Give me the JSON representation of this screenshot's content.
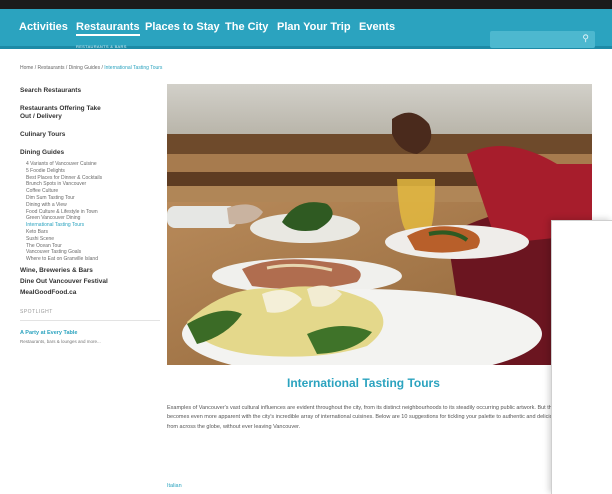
{
  "nav": {
    "items": [
      "Activities",
      "Restaurants",
      "Places to Stay",
      "The City",
      "Plan Your Trip",
      "Events"
    ],
    "active_sub": "RESTAURANTS & BARS"
  },
  "breadcrumb": {
    "home": "Home",
    "restaurants": "Restaurants",
    "guides": "Dining Guides",
    "current": "International Tasting Tours",
    "sep": "/"
  },
  "sidebar": {
    "search": "Search Restaurants",
    "offering": "Restaurants Offering Take Out / Delivery",
    "culinary": "Culinary Tours",
    "guides": "Dining Guides",
    "guide_items": [
      "4 Variants of Vancouver Cuisine",
      "5 Foodie Delights",
      "Best Places for Dinner & Cocktails",
      "Brunch Spots in Vancouver",
      "Coffee Culture",
      "Dim Sum Tasting Tour",
      "Dining with a View",
      "Food Culture & Lifestyle in Town",
      "Green Vancouver Dining",
      "International Tasting Tours",
      "Keto Bars",
      "Sushi Scene",
      "The Ocean Tour",
      "Vancouver Tasting Goals",
      "Where to Eat on Granville Island"
    ],
    "wine": "Wine, Breweries & Bars",
    "dine_out": "Dine Out Vancouver Festival",
    "ocean_wise": "MealGoodFood.ca",
    "spotlight": "SPOTLIGHT",
    "promo_title": "A Party at Every Table",
    "promo_desc": "Restaurants, bars & lounges and more..."
  },
  "main": {
    "title": "International Tasting Tours",
    "intro": "Examples of Vancouver's vast cultural influences are evident throughout the city, from its distinct neighbourhoods to its steadily occurring public artwork. But the cultural diversity becomes even more apparent with the city's incredible array of international cuisines. Below are 10 suggestions for tickling your palette to authentic and delicious culinary styles from across the globe, without ever leaving Vancouver.",
    "cta": "Italian"
  },
  "colors": {
    "brand": "#2ba3bf",
    "topbar": "#1b1b1b"
  },
  "icons": {
    "search": "magnifier"
  }
}
